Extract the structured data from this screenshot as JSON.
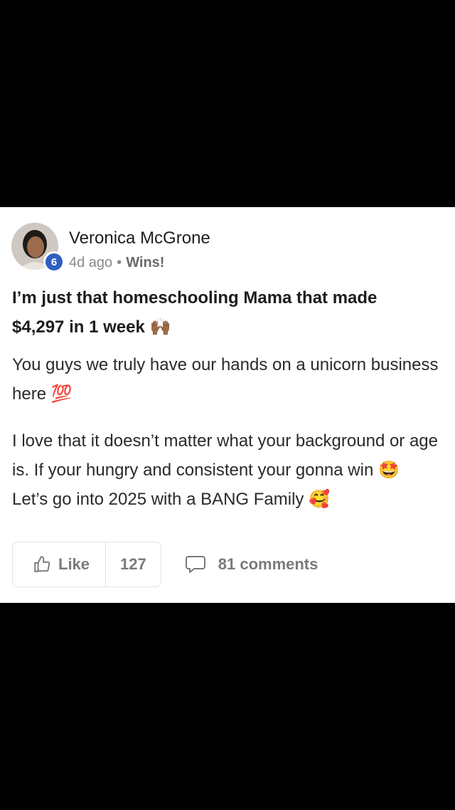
{
  "post": {
    "author": "Veronica McGrone",
    "level": "6",
    "time": "4d ago",
    "separator": "•",
    "category": "Wins!",
    "title_line1": "I’m just that homeschooling Mama that made",
    "title_line2": "$4,297 in 1 week",
    "title_emoji": "🙌🏾",
    "para1_text": "You guys we truly have our hands on a unicorn business here",
    "para1_emoji": "💯",
    "para2_text_a": "I love that it doesn’t matter what your background or age is. If your hungry and consistent your gonna win",
    "para2_emoji_a": "🤩",
    "para2_text_b": "Let’s go into 2025 with a BANG Family",
    "para2_emoji_b": "🥰"
  },
  "actions": {
    "like_label": "Like",
    "like_count": "127",
    "comments_label": "81 comments"
  },
  "icons": {
    "like": "thumbs-up-icon",
    "comment": "speech-bubble-icon"
  },
  "colors": {
    "badge": "#2e5fbf",
    "text": "#1d1d1d",
    "muted": "#8a8a8a"
  }
}
